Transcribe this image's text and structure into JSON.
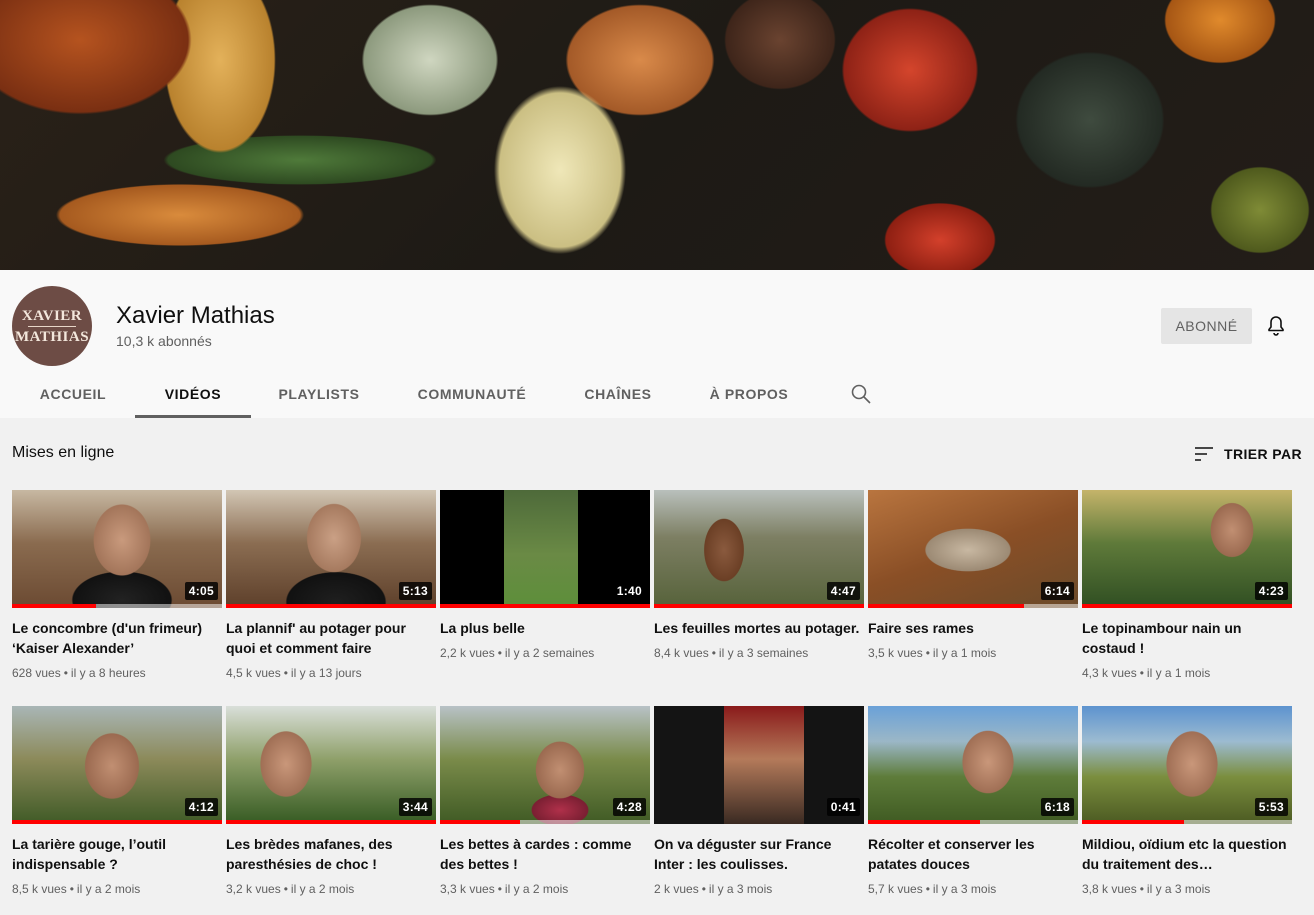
{
  "channel": {
    "name": "Xavier Mathias",
    "subscribers": "10,3 k abonnés",
    "avatar_line1": "XAVIER",
    "avatar_line2": "MATHIAS",
    "subscribe_label": "ABONNÉ"
  },
  "tabs": [
    {
      "label": "ACCUEIL"
    },
    {
      "label": "VIDÉOS",
      "active": true
    },
    {
      "label": "PLAYLISTS"
    },
    {
      "label": "COMMUNAUTÉ"
    },
    {
      "label": "CHAÎNES"
    },
    {
      "label": "À PROPOS"
    }
  ],
  "section": {
    "title": "Mises en ligne",
    "sort_label": "TRIER PAR"
  },
  "videos": [
    {
      "title": "Le concombre (d'un frimeur) ‘Kaiser Alexander’",
      "duration": "4:05",
      "views": "628 vues",
      "age": "il y a 8 heures",
      "watched_fraction": 0.4
    },
    {
      "title": "La plannif' au potager pour quoi et comment faire",
      "duration": "5:13",
      "views": "4,5 k vues",
      "age": "il y a 13 jours",
      "watched_fraction": 1
    },
    {
      "title": "La plus belle",
      "duration": "1:40",
      "views": "2,2 k vues",
      "age": "il y a 2 semaines",
      "watched_fraction": 1
    },
    {
      "title": "Les feuilles mortes au potager.",
      "duration": "4:47",
      "views": "8,4 k vues",
      "age": "il y a 3 semaines",
      "watched_fraction": 1
    },
    {
      "title": "Faire ses rames",
      "duration": "6:14",
      "views": "3,5 k vues",
      "age": "il y a 1 mois",
      "watched_fraction": 0.74
    },
    {
      "title": "Le topinambour nain un costaud !",
      "duration": "4:23",
      "views": "4,3 k vues",
      "age": "il y a 1 mois",
      "watched_fraction": 1
    },
    {
      "title": "La tarière gouge, l’outil indispensable ?",
      "duration": "4:12",
      "views": "8,5 k vues",
      "age": "il y a 2 mois",
      "watched_fraction": 1
    },
    {
      "title": "Les brèdes mafanes, des paresthésies de choc !",
      "duration": "3:44",
      "views": "3,2 k vues",
      "age": "il y a 2 mois",
      "watched_fraction": 1
    },
    {
      "title": "Les bettes à cardes : comme des bettes !",
      "duration": "4:28",
      "views": "3,3 k vues",
      "age": "il y a 2 mois",
      "watched_fraction": 0.38
    },
    {
      "title": "On va déguster sur France Inter : les coulisses.",
      "duration": "0:41",
      "views": "2 k vues",
      "age": "il y a 3 mois",
      "watched_fraction": 0
    },
    {
      "title": "Récolter et conserver les patates douces",
      "duration": "6:18",
      "views": "5,7 k vues",
      "age": "il y a 3 mois",
      "watched_fraction": 0.53
    },
    {
      "title": "Mildiou, oïdium etc la question du traitement des…",
      "duration": "5:53",
      "views": "3,8 k vues",
      "age": "il y a 3 mois",
      "watched_fraction": 0.49
    }
  ],
  "colors": {
    "progress": "#ff0000",
    "tab_indicator": "#606060"
  }
}
